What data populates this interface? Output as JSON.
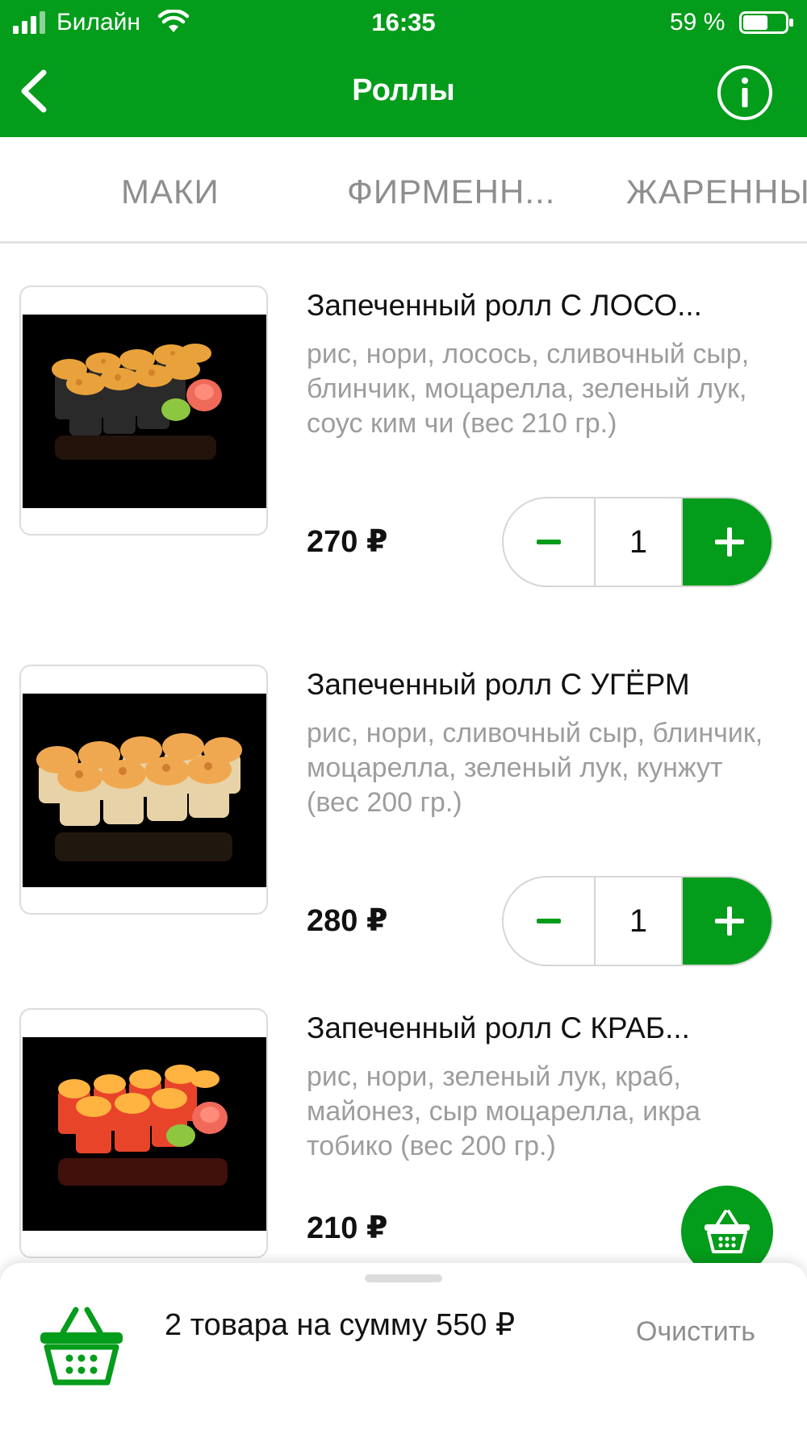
{
  "status_bar": {
    "carrier": "Билайн",
    "time": "16:35",
    "battery_percent": "59 %",
    "battery_level": 0.59,
    "icons": [
      "signal-icon",
      "wifi-icon",
      "battery-icon"
    ]
  },
  "nav": {
    "title": "Роллы",
    "back_icon": "chevron-left-icon",
    "info_icon": "info-icon"
  },
  "tabs": [
    {
      "label": "МАКИ"
    },
    {
      "label": "ФИРМЕНН..."
    },
    {
      "label": "ЖАРЕННЫ"
    }
  ],
  "products": [
    {
      "name": "Запеченный ролл С ЛОСО...",
      "description": "рис, нори, лосось, сливочный сыр, блинчик, моцарелла, зеленый лук, соус ким чи (вес 210 гр.)",
      "price": "270 ₽",
      "quantity": "1"
    },
    {
      "name": "Запеченный ролл С УГЁРМ",
      "description": "рис, нори, сливочный сыр, блинчик, моцарелла, зеленый лук, кунжут (вес 200 гр.)",
      "price": "280 ₽",
      "quantity": "1"
    },
    {
      "name": "Запеченный ролл С КРАБ...",
      "description": "рис, нори, зеленый лук, краб, майонез, сыр моцарелла, икра тобико (вес 200 гр.)",
      "price": "210 ₽"
    }
  ],
  "cart": {
    "summary": "2 товара на сумму 550 ₽",
    "clear_label": "Очистить",
    "icon": "basket-icon"
  },
  "colors": {
    "brand_green": "#049c1b",
    "muted_text": "#9d9d9d",
    "tab_text": "#8e8e8e"
  }
}
